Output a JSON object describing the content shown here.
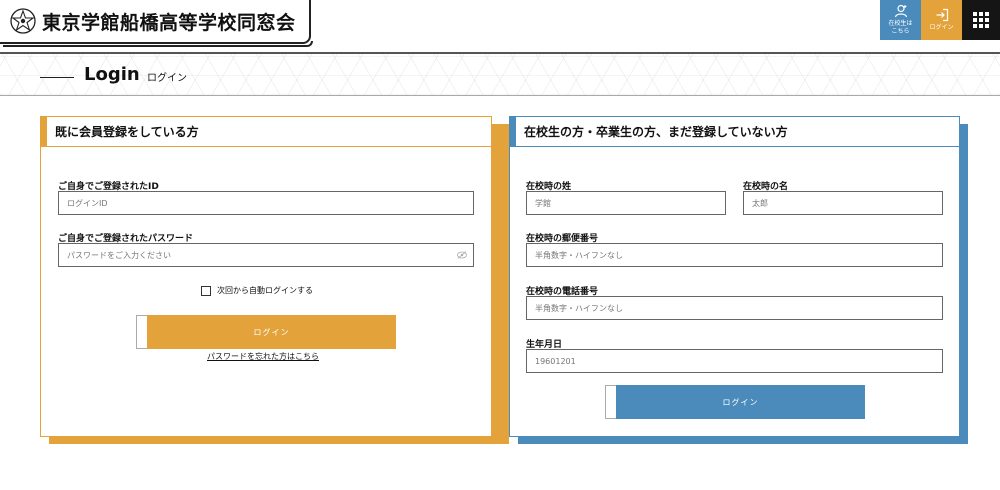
{
  "header": {
    "site_title": "東京学館船橋高等学校同窓会",
    "alumni_button": "在校生は\nこちら",
    "alumni_line1": "在校生は",
    "alumni_line2": "こちら",
    "login_button": "ログイン",
    "menu_icon": "grid-menu-icon",
    "emblem_icon": "school-emblem-icon"
  },
  "page": {
    "title_en": "Login",
    "title_ja": "ログイン"
  },
  "member_panel": {
    "heading": "既に会員登録をしている方",
    "id_label": "ご自身でご登録されたID",
    "id_placeholder": "ログインID",
    "password_label": "ご自身でご登録されたパスワード",
    "password_placeholder": "パスワードをご入力ください",
    "auto_login_label": "次回から自動ログインする",
    "login_button": "ログイン",
    "forgot_link": "パスワードを忘れた方はこちら",
    "accent_color": "#e3a33a"
  },
  "unregistered_panel": {
    "heading": "在校生の方・卒業生の方、まだ登録していない方",
    "surname_label": "在校時の姓",
    "surname_placeholder": "学館",
    "given_name_label": "在校時の名",
    "given_name_placeholder": "太郎",
    "postal_label": "在校時の郵便番号",
    "postal_placeholder": "半角数字・ハイフンなし",
    "phone_label": "在校時の電話番号",
    "phone_placeholder": "半角数字・ハイフンなし",
    "birthdate_label": "生年月日",
    "birthdate_placeholder": "19601201",
    "login_button": "ログイン",
    "accent_color": "#4a8bbb"
  }
}
